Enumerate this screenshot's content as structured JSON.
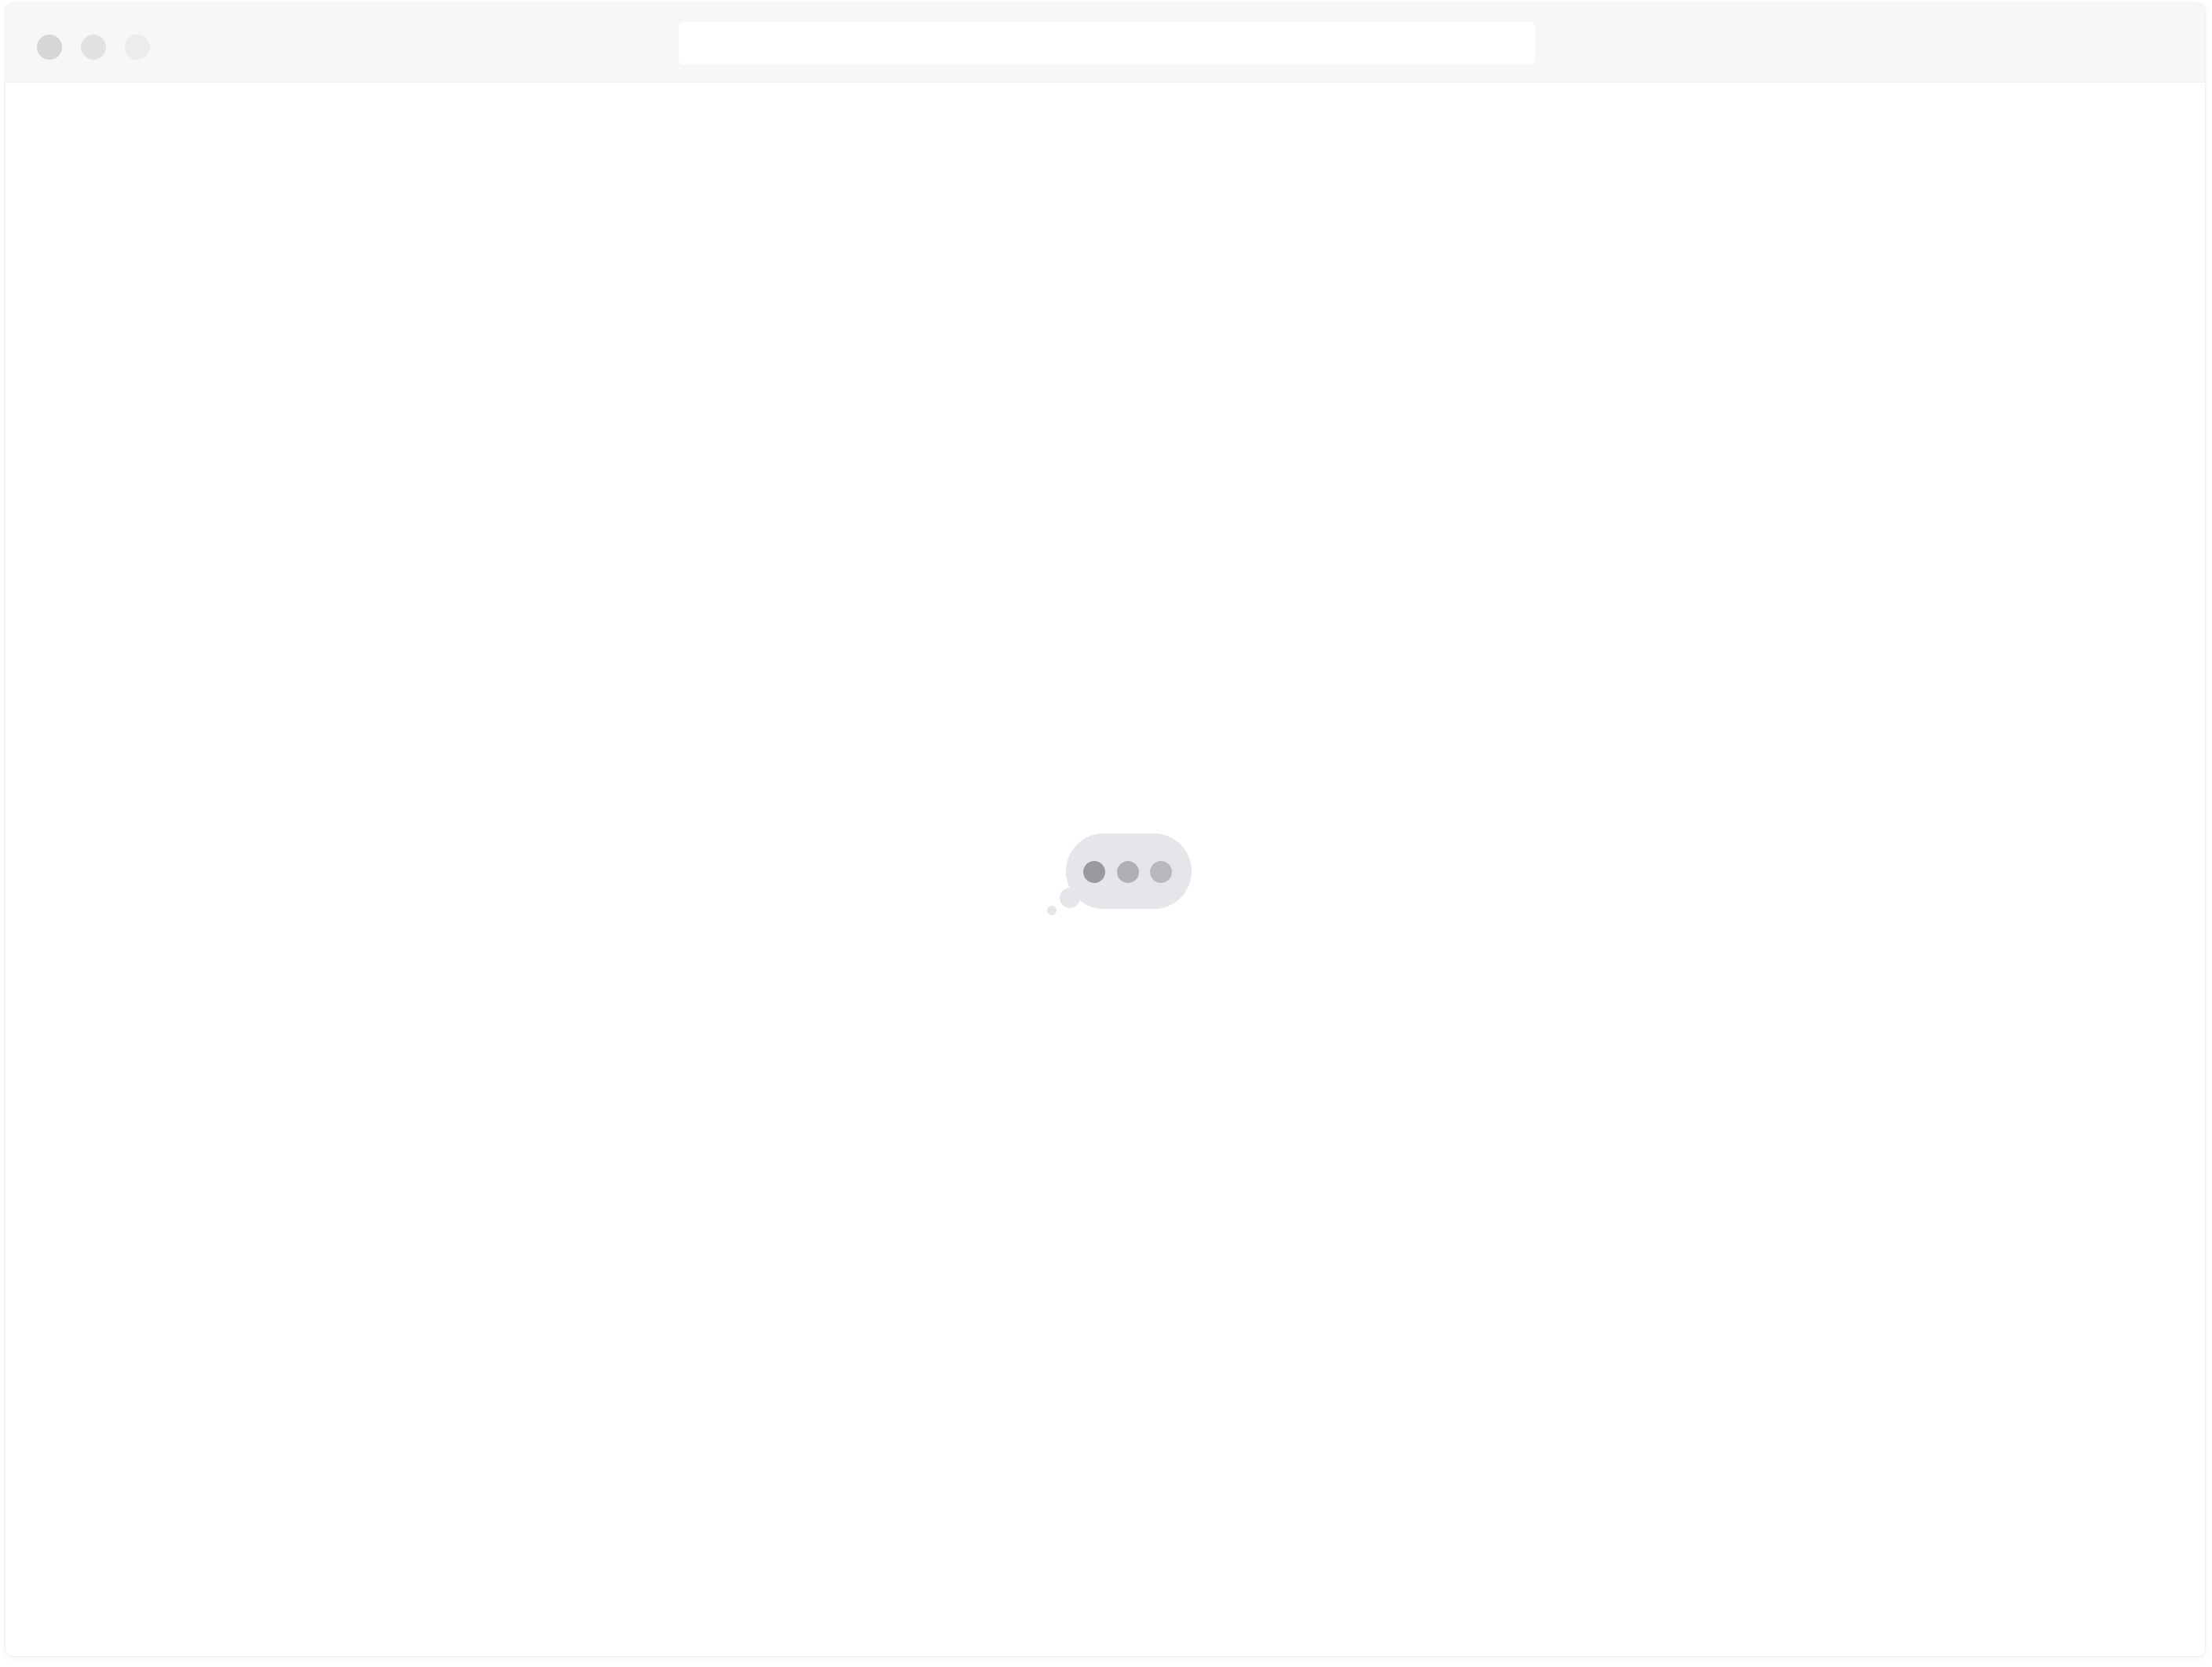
{
  "window": {
    "traffic_lights": [
      "close",
      "minimize",
      "maximize"
    ],
    "address_bar": {
      "value": "",
      "placeholder": ""
    }
  },
  "content": {
    "state": "loading",
    "indicator_icon": "typing-indicator-icon"
  },
  "colors": {
    "titlebar": "#f7f7f7",
    "bubble": "#e5e5ea",
    "dot_dark": "#9a9a9e",
    "dot_mid": "#b0b0b4",
    "dot_light": "#b8b8bc"
  }
}
